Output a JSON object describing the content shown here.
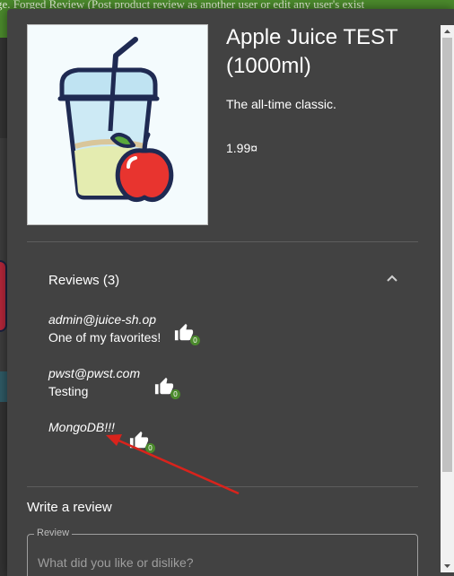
{
  "background": {
    "topbar_text": "ge. Forged Review (Post product review as another user or edit any user's exist"
  },
  "product": {
    "title": "Apple Juice TEST (1000ml)",
    "description": "The all-time classic.",
    "price": "1.99¤",
    "image_icon": "apple-juice-image"
  },
  "reviews": {
    "header": "Reviews (3)",
    "items": [
      {
        "author": "admin@juice-sh.op",
        "text": "One of my favorites!",
        "likes": "0"
      },
      {
        "author": "pwst@pwst.com",
        "text": "Testing",
        "likes": "0"
      },
      {
        "author": "MongoDB!!!",
        "text": "",
        "likes": "0"
      }
    ]
  },
  "write_review": {
    "title": "Write a review",
    "field_label": "Review",
    "placeholder": "What did you like or dislike?"
  },
  "colors": {
    "dialog_bg": "#424242",
    "accent_green": "#4b8a2c",
    "annotation_arrow": "#d9231c"
  }
}
